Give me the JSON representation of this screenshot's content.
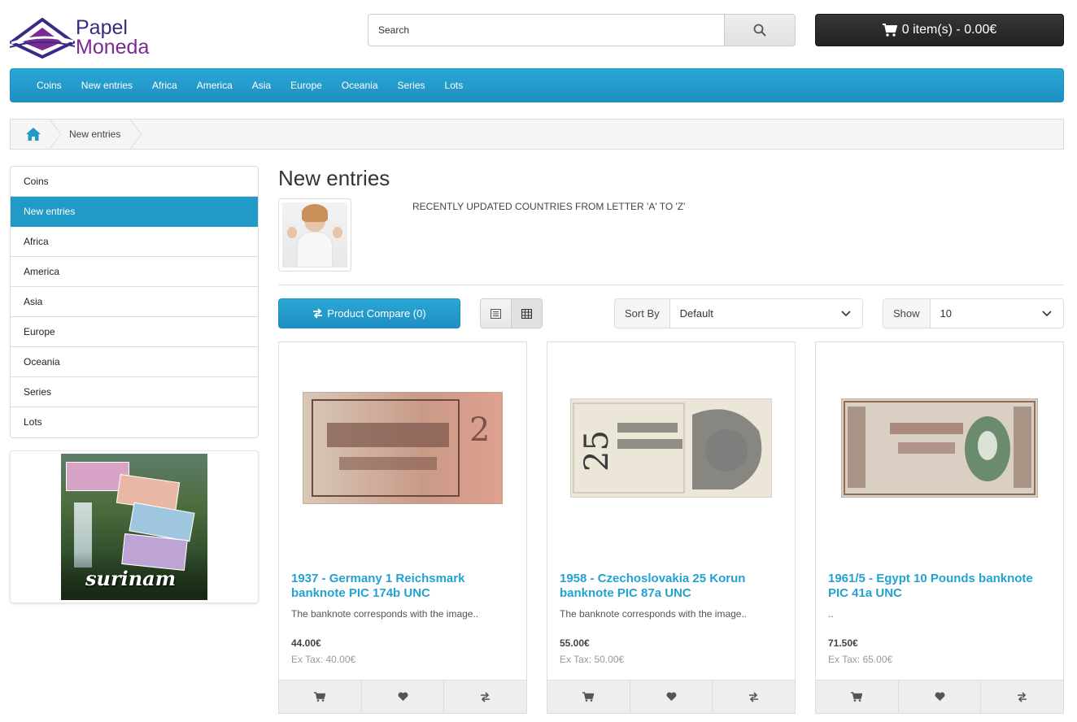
{
  "brand": {
    "line1": "Papel",
    "line2": "Moneda"
  },
  "search": {
    "placeholder": "Search"
  },
  "cart": {
    "label": "0 item(s) - 0.00€"
  },
  "menu": [
    "Coins",
    "New entries",
    "Africa",
    "America",
    "Asia",
    "Europe",
    "Oceania",
    "Series",
    "Lots"
  ],
  "breadcrumb": {
    "current": "New entries"
  },
  "sidebar": {
    "items": [
      "Coins",
      "New entries",
      "Africa",
      "America",
      "Asia",
      "Europe",
      "Oceania",
      "Series",
      "Lots"
    ],
    "active": "New entries",
    "banner_text": "surinam"
  },
  "page": {
    "title": "New entries",
    "description": "RECENTLY UPDATED COUNTRIES FROM LETTER 'A' TO 'Z'"
  },
  "toolbar": {
    "compare_label": "Product Compare (0)",
    "sort_label": "Sort By",
    "sort_value": "Default",
    "show_label": "Show",
    "show_value": "10"
  },
  "products": [
    {
      "name": "1937 - Germany 1 Reichsmark banknote PIC 174b UNC",
      "desc": "The banknote corresponds with the image..",
      "price": "44.00€",
      "extax": "Ex Tax: 40.00€"
    },
    {
      "name": "1958 - Czechoslovakia 25 Korun banknote PIC 87a UNC",
      "desc": "The banknote corresponds with the image..",
      "price": "55.00€",
      "extax": "Ex Tax: 50.00€"
    },
    {
      "name": "1961/5 - Egypt 10 Pounds banknote PIC 41a UNC",
      "desc": "..",
      "price": "71.50€",
      "extax": "Ex Tax: 65.00€"
    }
  ],
  "colors": {
    "accent": "#229ac8",
    "link": "#23a1d1",
    "cart_bg": "#2b2b2b"
  },
  "icons": {
    "search": "search-icon",
    "cart": "cart-icon",
    "home": "home-icon",
    "compare": "compare-icon",
    "list": "list-view-icon",
    "grid": "grid-view-icon",
    "wishlist": "heart-icon",
    "chevron": "chevron-down-icon"
  }
}
